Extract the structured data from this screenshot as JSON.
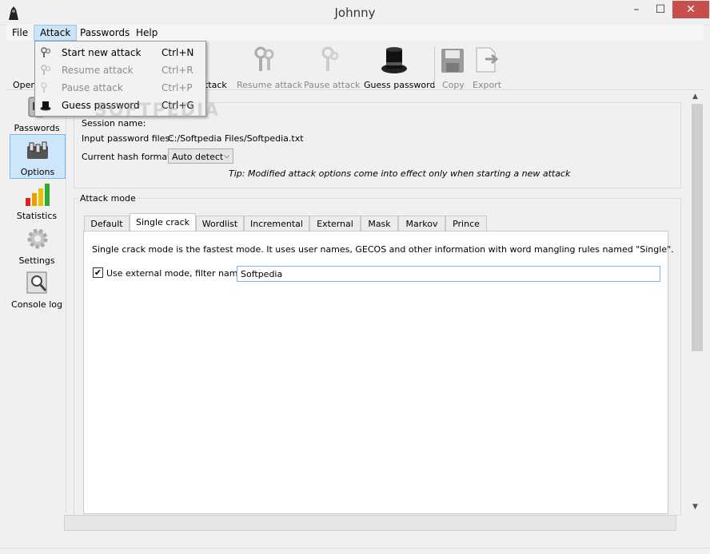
{
  "window": {
    "title": "Johnny",
    "min_glyph": "–",
    "max_glyph": "☐",
    "close_glyph": "✕"
  },
  "menubar": {
    "items": [
      "File",
      "Attack",
      "Passwords",
      "Help"
    ]
  },
  "toolbar": {
    "open_label": "Open",
    "start_attack_partial": "ttack",
    "resume_attack": "Resume attack",
    "pause_attack": "Pause attack",
    "guess_password": "Guess password",
    "copy": "Copy",
    "export": "Export"
  },
  "attack_menu": {
    "items": [
      {
        "label": "Start new attack",
        "shortcut": "Ctrl+N",
        "enabled": true,
        "icon": "keys-icon"
      },
      {
        "label": "Resume attack",
        "shortcut": "Ctrl+R",
        "enabled": false,
        "icon": "keys-icon"
      },
      {
        "label": "Pause attack",
        "shortcut": "Ctrl+P",
        "enabled": false,
        "icon": "keys-icon"
      },
      {
        "label": "Guess password",
        "shortcut": "Ctrl+G",
        "enabled": true,
        "icon": "top-hat-icon"
      }
    ]
  },
  "sidebar": {
    "items": [
      {
        "label": "Passwords",
        "selected": false
      },
      {
        "label": "Options",
        "selected": true
      },
      {
        "label": "Statistics",
        "selected": false
      },
      {
        "label": "Settings",
        "selected": false
      },
      {
        "label": "Console log",
        "selected": false
      }
    ]
  },
  "session": {
    "session_name_label": "Session name:",
    "input_files_label": "Input password files:",
    "input_files_value": "C:/Softpedia Files/Softpedia.txt",
    "hash_format_label": "Current hash format:",
    "hash_format_value": "Auto detect",
    "tip": "Tip: Modified attack options come into effect only when starting a new attack"
  },
  "attack_mode": {
    "group_label": "Attack mode",
    "tabs": [
      "Default",
      "Single crack",
      "Wordlist",
      "Incremental",
      "External",
      "Mask",
      "Markov",
      "Prince"
    ],
    "active_tab": "Single crack",
    "description": "Single crack mode is the fastest mode. It uses user names, GECOS and other information with word mangling rules named \"Single\".",
    "use_external_label": "Use external mode, filter name:",
    "use_external_checked": true,
    "filter_name": "Softpedia"
  },
  "watermark": "SOFTPEDIA",
  "colors": {
    "selection": "#cde6fb",
    "close_button": "#c7504f",
    "menu_highlight": "#cce4f7"
  }
}
